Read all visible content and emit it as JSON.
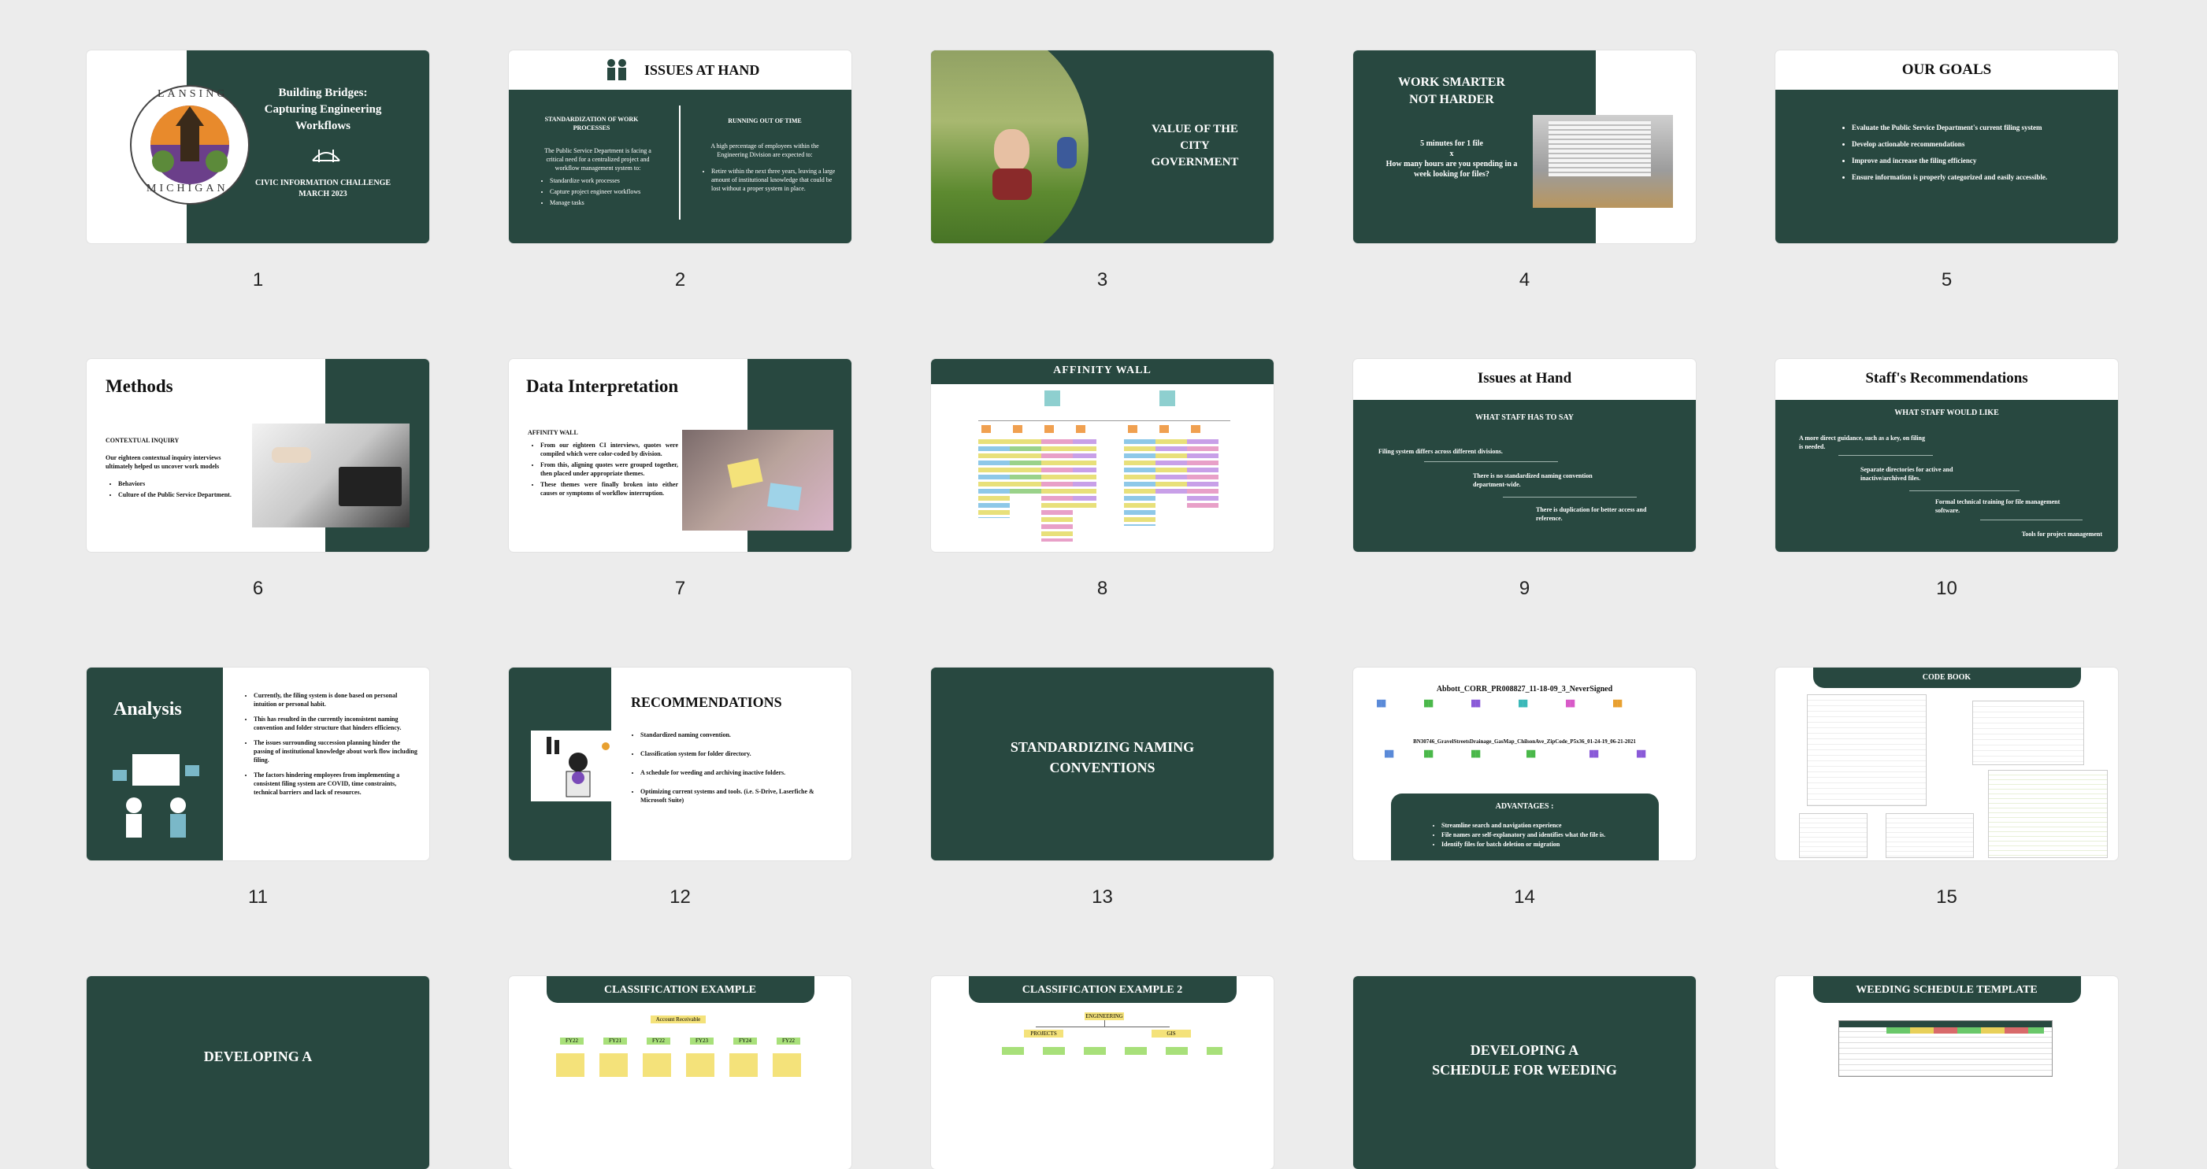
{
  "slides": [
    {
      "num": "1",
      "title": "Building Bridges: Capturing Engineering Workflows",
      "subtitle": "CIVIC INFORMATION CHALLENGE\nMARCH 2023",
      "seal_top": "LANSING",
      "seal_bottom": "MICHIGAN"
    },
    {
      "num": "2",
      "title": "ISSUES AT HAND",
      "left_heading": "STANDARDIZATION OF WORK PROCESSES",
      "left_body": "The Public Service Department is facing a critical need for a centralized project and workflow management system to:",
      "left_bullets": [
        "Standardize work processes",
        "Capture project engineer workflows",
        "Manage tasks"
      ],
      "right_heading": "RUNNING OUT OF TIME",
      "right_body": "A high percentage of employees within the Engineering Division are expected to:",
      "right_bullets": [
        "Retire within the next three years, leaving a large amount of institutional knowledge that could be lost without a proper system in place."
      ]
    },
    {
      "num": "3",
      "title": "VALUE OF THE CITY GOVERNMENT"
    },
    {
      "num": "4",
      "title": "WORK SMARTER NOT HARDER",
      "line1": "5 minutes for 1 file",
      "line2": "x",
      "line3": "How many hours are you spending in a week looking for files?"
    },
    {
      "num": "5",
      "title": "OUR GOALS",
      "bullets": [
        "Evaluate the Public Service Department's current filing system",
        "Develop actionable recommendations",
        "Improve and increase the filing efficiency",
        "Ensure information is properly categorized and easily accessible."
      ]
    },
    {
      "num": "6",
      "title": "Methods",
      "heading": "CONTEXTUAL INQUIRY",
      "body": "Our eighteen contextual inquiry interviews ultimately helped us uncover work models",
      "bullets": [
        "Behaviors",
        "Culture of the Public Service Department."
      ]
    },
    {
      "num": "7",
      "title": "Data Interpretation",
      "heading": "AFFINITY WALL",
      "bullets": [
        "From our eighteen CI interviews, quotes were compiled which were color-coded by division.",
        "From this, aligning quotes were grouped together, then placed under appropriate themes.",
        "These themes were finally broken into either causes or symptoms of workflow interruption."
      ]
    },
    {
      "num": "8",
      "title": "AFFINITY WALL"
    },
    {
      "num": "9",
      "title": "Issues at Hand",
      "heading": "WHAT STAFF HAS TO SAY",
      "items": [
        "Filing system differs across different divisions.",
        "There is no standardized naming convention department-wide.",
        "There is duplication for better access and reference."
      ]
    },
    {
      "num": "10",
      "title": "Staff's Recommendations",
      "heading": "WHAT STAFF WOULD LIKE",
      "items": [
        "A more direct guidance, such as a key, on filing is needed.",
        "Separate directories for active and inactive/archived files.",
        "Formal technical training for file management software.",
        "Tools for project management"
      ]
    },
    {
      "num": "11",
      "title": "Analysis",
      "bullets": [
        "Currently, the filing system is done based on personal intuition or personal habit.",
        "This has resulted in the currently inconsistent naming convention and folder structure that hinders efficiency.",
        "The issues surrounding succession planning hinder the passing of institutional knowledge about work flow including filing.",
        "The factors hindering employees from implementing a consistent filing system are COVID, time constraints, technical barriers and lack of resources."
      ]
    },
    {
      "num": "12",
      "title": "RECOMMENDATIONS",
      "bullets": [
        "Standardized naming convention.",
        "Classification system for folder directory.",
        "A schedule for weeding and archiving inactive folders.",
        "Optimizing current systems and tools. (i.e. S-Drive, Laserfiche & Microsoft Suite)"
      ]
    },
    {
      "num": "13",
      "title": "STANDARDIZING NAMING CONVENTIONS"
    },
    {
      "num": "14",
      "filename1": "Abbott_CORR_PR008827_11-18-09_3_NeverSigned",
      "filename2": "BN30746_GravelStreetsDrainage_GasMap_ChilsonAve_ZipCode_P5x36_01-24-19_06-21-2021",
      "heading": "ADVANTAGES :",
      "bullets": [
        "Streamline search and navigation experience",
        "File names are self-explanatory and identifies what the file is.",
        "Identify files for batch deletion or migration"
      ]
    },
    {
      "num": "15",
      "title": "CODE BOOK"
    },
    {
      "num": "",
      "title": "DEVELOPING A"
    },
    {
      "num": "",
      "title": "CLASSIFICATION EXAMPLE",
      "box_top": "Account Receivable",
      "boxes": [
        "FY22",
        "FY21",
        "FY22",
        "FY23",
        "FY24",
        "FY22"
      ]
    },
    {
      "num": "",
      "title": "CLASSIFICATION EXAMPLE 2",
      "box_top": "ENGINEERING",
      "boxes": [
        "PROJECTS",
        "GIS"
      ]
    },
    {
      "num": "",
      "title": "DEVELOPING A SCHEDULE FOR WEEDING"
    },
    {
      "num": "",
      "title": "WEEDING SCHEDULE TEMPLATE"
    }
  ],
  "colors": {
    "dark_green": "#284840",
    "background": "#ececec"
  }
}
